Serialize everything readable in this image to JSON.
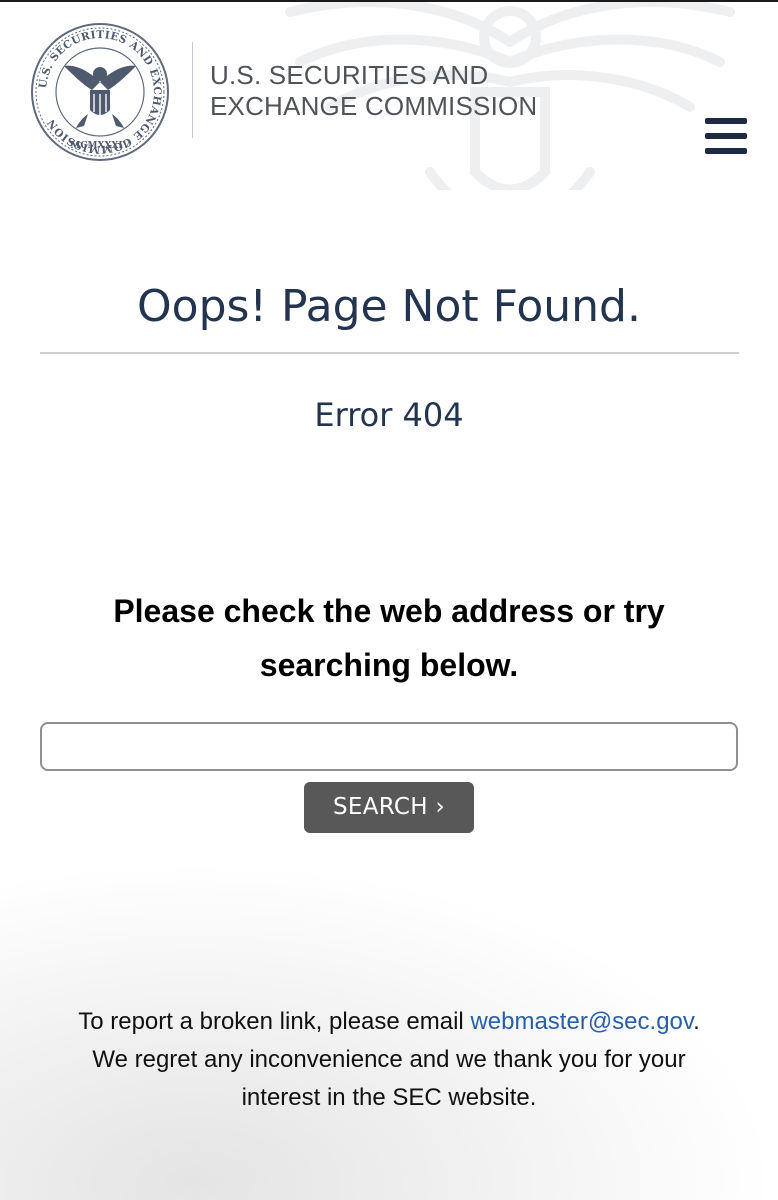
{
  "header": {
    "seal": {
      "ring_text": "U.S. SECURITIES AND EXCHANGE COMMISSION",
      "year": "MCMXXXIV"
    },
    "agency_line1": "U.S. SECURITIES AND",
    "agency_line2": "EXCHANGE COMMISSION",
    "menu_icon": "hamburger-menu-icon"
  },
  "error_page": {
    "title": "Oops! Page Not Found.",
    "error_code": "Error 404",
    "instructions_line1": "Please check the web address or try",
    "instructions_line2": "searching below."
  },
  "search": {
    "value": "",
    "placeholder": "",
    "button_label": "SEARCH ›"
  },
  "footer": {
    "report_prefix": "To report a broken link, please email",
    "email": "webmaster@sec.gov",
    "report_suffix": ".",
    "line2": "We regret any inconvenience and we thank you for your",
    "line3": "interest in the SEC website."
  },
  "colors": {
    "navy_heading": "#22344f",
    "menu_bars": "#1d2a44",
    "agency_text": "#505358",
    "link": "#2a5fa5",
    "search_button": "#585858"
  }
}
